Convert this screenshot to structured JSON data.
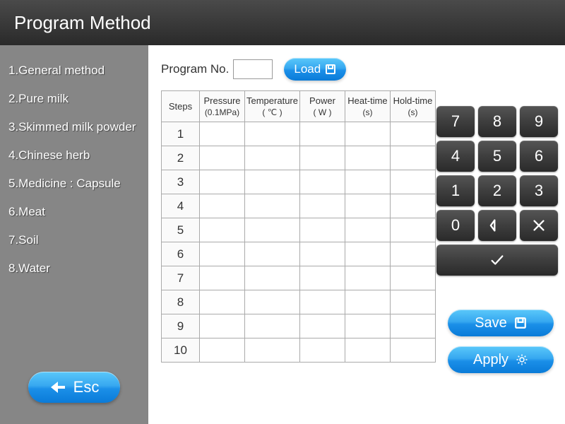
{
  "title": "Program Method",
  "sidebar": {
    "items": [
      {
        "label": "1.General method"
      },
      {
        "label": "2.Pure milk"
      },
      {
        "label": "3.Skimmed milk powder"
      },
      {
        "label": "4.Chinese herb"
      },
      {
        "label": "5.Medicine : Capsule"
      },
      {
        "label": "6.Meat"
      },
      {
        "label": "7.Soil"
      },
      {
        "label": "8.Water"
      }
    ],
    "esc_label": "Esc"
  },
  "program": {
    "label": "Program No.",
    "value": "",
    "load_label": "Load"
  },
  "table": {
    "headers": {
      "steps": "Steps",
      "pressure": "Pressure",
      "pressure_unit": "(0.1MPa)",
      "temperature": "Temperature",
      "temperature_unit": "( ℃ )",
      "power": "Power",
      "power_unit": "( W )",
      "heat_time": "Heat-time",
      "heat_time_unit": "(s)",
      "hold_time": "Hold-time",
      "hold_time_unit": "(s)"
    },
    "rows": [
      {
        "step": "1",
        "pressure": "",
        "temperature": "",
        "power": "",
        "heat_time": "",
        "hold_time": ""
      },
      {
        "step": "2",
        "pressure": "",
        "temperature": "",
        "power": "",
        "heat_time": "",
        "hold_time": ""
      },
      {
        "step": "3",
        "pressure": "",
        "temperature": "",
        "power": "",
        "heat_time": "",
        "hold_time": ""
      },
      {
        "step": "4",
        "pressure": "",
        "temperature": "",
        "power": "",
        "heat_time": "",
        "hold_time": ""
      },
      {
        "step": "5",
        "pressure": "",
        "temperature": "",
        "power": "",
        "heat_time": "",
        "hold_time": ""
      },
      {
        "step": "6",
        "pressure": "",
        "temperature": "",
        "power": "",
        "heat_time": "",
        "hold_time": ""
      },
      {
        "step": "7",
        "pressure": "",
        "temperature": "",
        "power": "",
        "heat_time": "",
        "hold_time": ""
      },
      {
        "step": "8",
        "pressure": "",
        "temperature": "",
        "power": "",
        "heat_time": "",
        "hold_time": ""
      },
      {
        "step": "9",
        "pressure": "",
        "temperature": "",
        "power": "",
        "heat_time": "",
        "hold_time": ""
      },
      {
        "step": "10",
        "pressure": "",
        "temperature": "",
        "power": "",
        "heat_time": "",
        "hold_time": ""
      }
    ]
  },
  "keypad": {
    "k7": "7",
    "k8": "8",
    "k9": "9",
    "k4": "4",
    "k5": "5",
    "k6": "6",
    "k1": "1",
    "k2": "2",
    "k3": "3",
    "k0": "0"
  },
  "actions": {
    "save_label": "Save",
    "apply_label": "Apply"
  }
}
